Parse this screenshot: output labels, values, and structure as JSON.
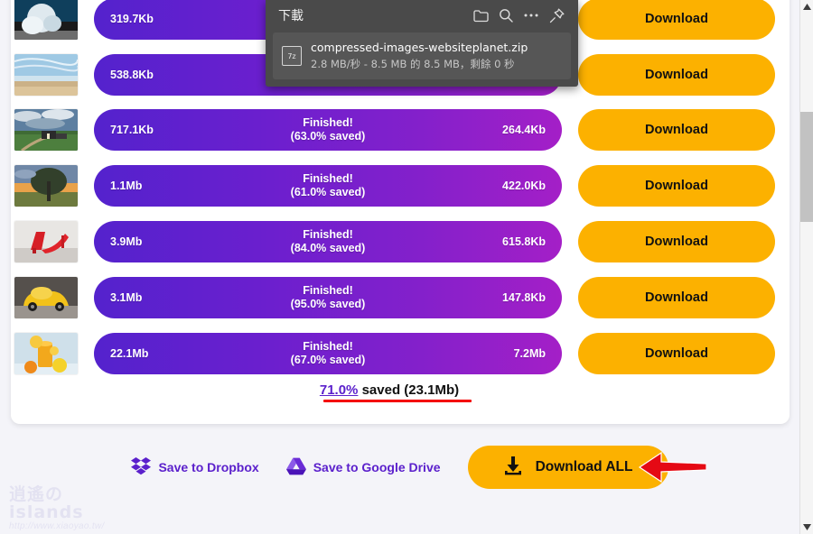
{
  "app": {
    "accent_purple": "#5b20cc",
    "accent_yellow": "#fcb100",
    "annotation_red": "#f40000"
  },
  "results": {
    "rows": [
      {
        "thumb": "geyser-photo",
        "original_size": "319.7Kb",
        "status": "",
        "saved": "",
        "new_size": "",
        "download_label": "Download"
      },
      {
        "thumb": "beach-photo",
        "original_size": "538.8Kb",
        "status": "",
        "saved": "",
        "new_size": "",
        "download_label": "Download"
      },
      {
        "thumb": "farmhouse-photo",
        "original_size": "717.1Kb",
        "status": "Finished!",
        "saved": "(63.0% saved)",
        "new_size": "264.4Kb",
        "download_label": "Download"
      },
      {
        "thumb": "tree-sunset-photo",
        "original_size": "1.1Mb",
        "status": "Finished!",
        "saved": "(61.0% saved)",
        "new_size": "422.0Kb",
        "download_label": "Download"
      },
      {
        "thumb": "red-heels-photo",
        "original_size": "3.9Mb",
        "status": "Finished!",
        "saved": "(84.0% saved)",
        "new_size": "615.8Kb",
        "download_label": "Download"
      },
      {
        "thumb": "yellow-car-photo",
        "original_size": "3.1Mb",
        "status": "Finished!",
        "saved": "(95.0% saved)",
        "new_size": "147.8Kb",
        "download_label": "Download"
      },
      {
        "thumb": "orange-juice-photo",
        "original_size": "22.1Mb",
        "status": "Finished!",
        "saved": "(67.0% saved)",
        "new_size": "7.2Mb",
        "download_label": "Download"
      }
    ],
    "total_percent": "71.0%",
    "total_suffix": " saved (23.1Mb)"
  },
  "footer": {
    "dropbox_label": "Save to Dropbox",
    "gdrive_label": "Save to Google Drive",
    "download_all_label": "Download ALL"
  },
  "download_popup": {
    "title": "下載",
    "filename": "compressed-images-websiteplanet.zip",
    "status": "2.8 MB/秒 - 8.5 MB 的 8.5 MB，剩餘 0 秒",
    "file_type_badge": "7z",
    "icons": {
      "folder": "folder-icon",
      "search": "search-icon",
      "more": "more-options-icon",
      "pin": "pin-icon"
    }
  },
  "watermark": {
    "logo": "逍遙の islands",
    "url": "http://www.xiaoyao.tw/"
  }
}
